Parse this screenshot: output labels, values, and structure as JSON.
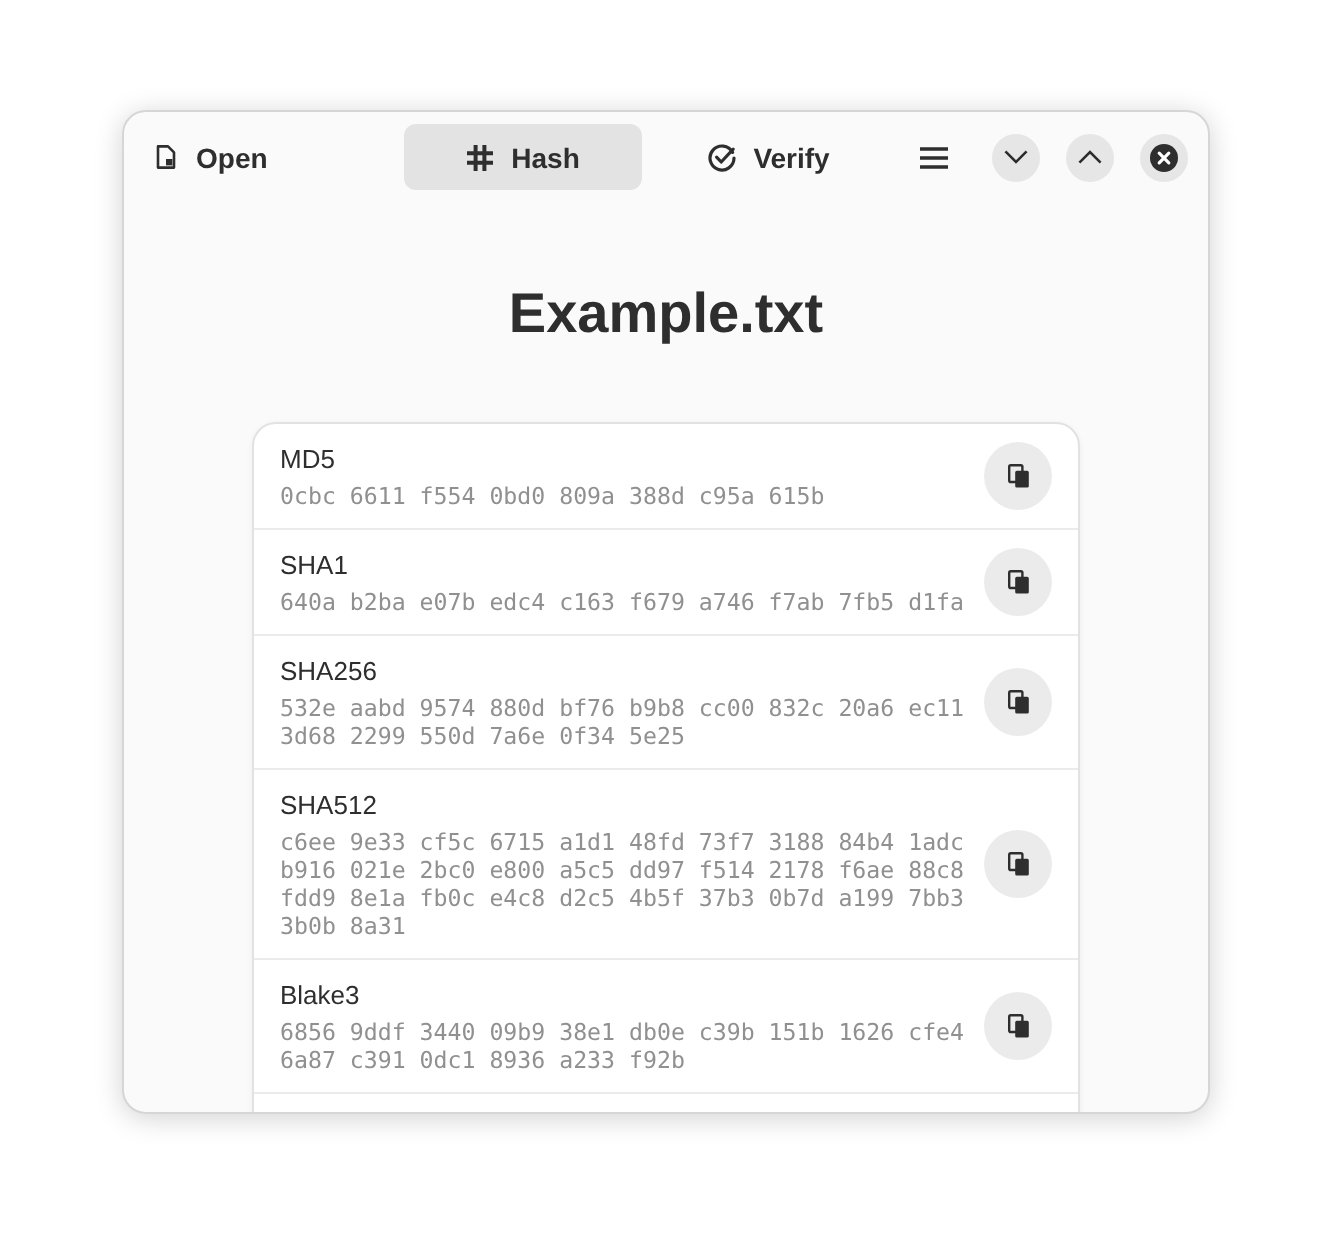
{
  "header": {
    "open_button": {
      "label": "Open"
    },
    "tabs": [
      {
        "label": "Hash",
        "kind": "hash",
        "selected": true
      },
      {
        "label": "Verify",
        "kind": "verify",
        "selected": false
      }
    ]
  },
  "title": "Example.txt",
  "hashes": [
    {
      "name": "MD5",
      "value": "0cbc 6611 f554 0bd0 809a 388d c95a 615b"
    },
    {
      "name": "SHA1",
      "value": "640a b2ba e07b edc4 c163 f679 a746 f7ab 7fb5 d1fa"
    },
    {
      "name": "SHA256",
      "value": "532e aabd 9574 880d bf76 b9b8 cc00 832c 20a6 ec11 3d68 2299 550d 7a6e 0f34 5e25"
    },
    {
      "name": "SHA512",
      "value": "c6ee 9e33 cf5c 6715 a1d1 48fd 73f7 3188 84b4 1adc b916 021e 2bc0 e800 a5c5 dd97 f514 2178 f6ae 88c8 fdd9 8e1a fb0c e4c8 d2c5 4b5f 37b3 0b7d a199 7bb3 3b0b 8a31"
    },
    {
      "name": "Blake3",
      "value": "6856 9ddf 3440 09b9 38e1 db0e c39b 151b 1626 cfe4 6a87 c391 0dc1 8936 a233 f92b"
    }
  ]
}
